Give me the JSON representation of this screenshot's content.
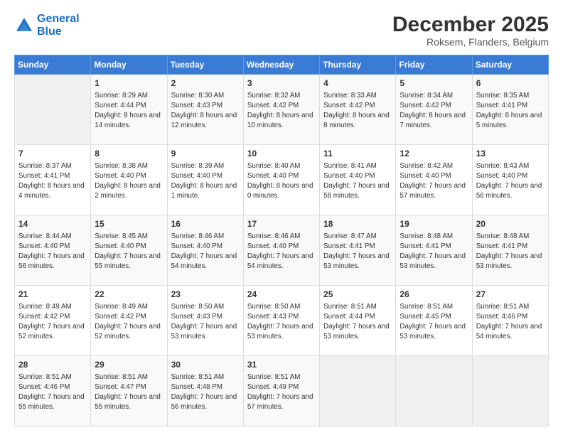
{
  "logo": {
    "line1": "General",
    "line2": "Blue"
  },
  "calendar": {
    "title": "December 2025",
    "subtitle": "Roksem, Flanders, Belgium",
    "days_header": [
      "Sunday",
      "Monday",
      "Tuesday",
      "Wednesday",
      "Thursday",
      "Friday",
      "Saturday"
    ],
    "weeks": [
      [
        {
          "day": "",
          "sunrise": "",
          "sunset": "",
          "daylight": "",
          "empty": true
        },
        {
          "day": "1",
          "sunrise": "Sunrise: 8:29 AM",
          "sunset": "Sunset: 4:44 PM",
          "daylight": "Daylight: 8 hours and 14 minutes."
        },
        {
          "day": "2",
          "sunrise": "Sunrise: 8:30 AM",
          "sunset": "Sunset: 4:43 PM",
          "daylight": "Daylight: 8 hours and 12 minutes."
        },
        {
          "day": "3",
          "sunrise": "Sunrise: 8:32 AM",
          "sunset": "Sunset: 4:42 PM",
          "daylight": "Daylight: 8 hours and 10 minutes."
        },
        {
          "day": "4",
          "sunrise": "Sunrise: 8:33 AM",
          "sunset": "Sunset: 4:42 PM",
          "daylight": "Daylight: 8 hours and 8 minutes."
        },
        {
          "day": "5",
          "sunrise": "Sunrise: 8:34 AM",
          "sunset": "Sunset: 4:42 PM",
          "daylight": "Daylight: 8 hours and 7 minutes."
        },
        {
          "day": "6",
          "sunrise": "Sunrise: 8:35 AM",
          "sunset": "Sunset: 4:41 PM",
          "daylight": "Daylight: 8 hours and 5 minutes."
        }
      ],
      [
        {
          "day": "7",
          "sunrise": "Sunrise: 8:37 AM",
          "sunset": "Sunset: 4:41 PM",
          "daylight": "Daylight: 8 hours and 4 minutes."
        },
        {
          "day": "8",
          "sunrise": "Sunrise: 8:38 AM",
          "sunset": "Sunset: 4:40 PM",
          "daylight": "Daylight: 8 hours and 2 minutes."
        },
        {
          "day": "9",
          "sunrise": "Sunrise: 8:39 AM",
          "sunset": "Sunset: 4:40 PM",
          "daylight": "Daylight: 8 hours and 1 minute."
        },
        {
          "day": "10",
          "sunrise": "Sunrise: 8:40 AM",
          "sunset": "Sunset: 4:40 PM",
          "daylight": "Daylight: 8 hours and 0 minutes."
        },
        {
          "day": "11",
          "sunrise": "Sunrise: 8:41 AM",
          "sunset": "Sunset: 4:40 PM",
          "daylight": "Daylight: 7 hours and 58 minutes."
        },
        {
          "day": "12",
          "sunrise": "Sunrise: 8:42 AM",
          "sunset": "Sunset: 4:40 PM",
          "daylight": "Daylight: 7 hours and 57 minutes."
        },
        {
          "day": "13",
          "sunrise": "Sunrise: 8:43 AM",
          "sunset": "Sunset: 4:40 PM",
          "daylight": "Daylight: 7 hours and 56 minutes."
        }
      ],
      [
        {
          "day": "14",
          "sunrise": "Sunrise: 8:44 AM",
          "sunset": "Sunset: 4:40 PM",
          "daylight": "Daylight: 7 hours and 56 minutes."
        },
        {
          "day": "15",
          "sunrise": "Sunrise: 8:45 AM",
          "sunset": "Sunset: 4:40 PM",
          "daylight": "Daylight: 7 hours and 55 minutes."
        },
        {
          "day": "16",
          "sunrise": "Sunrise: 8:46 AM",
          "sunset": "Sunset: 4:40 PM",
          "daylight": "Daylight: 7 hours and 54 minutes."
        },
        {
          "day": "17",
          "sunrise": "Sunrise: 8:46 AM",
          "sunset": "Sunset: 4:40 PM",
          "daylight": "Daylight: 7 hours and 54 minutes."
        },
        {
          "day": "18",
          "sunrise": "Sunrise: 8:47 AM",
          "sunset": "Sunset: 4:41 PM",
          "daylight": "Daylight: 7 hours and 53 minutes."
        },
        {
          "day": "19",
          "sunrise": "Sunrise: 8:48 AM",
          "sunset": "Sunset: 4:41 PM",
          "daylight": "Daylight: 7 hours and 53 minutes."
        },
        {
          "day": "20",
          "sunrise": "Sunrise: 8:48 AM",
          "sunset": "Sunset: 4:41 PM",
          "daylight": "Daylight: 7 hours and 53 minutes."
        }
      ],
      [
        {
          "day": "21",
          "sunrise": "Sunrise: 8:49 AM",
          "sunset": "Sunset: 4:42 PM",
          "daylight": "Daylight: 7 hours and 52 minutes."
        },
        {
          "day": "22",
          "sunrise": "Sunrise: 8:49 AM",
          "sunset": "Sunset: 4:42 PM",
          "daylight": "Daylight: 7 hours and 52 minutes."
        },
        {
          "day": "23",
          "sunrise": "Sunrise: 8:50 AM",
          "sunset": "Sunset: 4:43 PM",
          "daylight": "Daylight: 7 hours and 53 minutes."
        },
        {
          "day": "24",
          "sunrise": "Sunrise: 8:50 AM",
          "sunset": "Sunset: 4:43 PM",
          "daylight": "Daylight: 7 hours and 53 minutes."
        },
        {
          "day": "25",
          "sunrise": "Sunrise: 8:51 AM",
          "sunset": "Sunset: 4:44 PM",
          "daylight": "Daylight: 7 hours and 53 minutes."
        },
        {
          "day": "26",
          "sunrise": "Sunrise: 8:51 AM",
          "sunset": "Sunset: 4:45 PM",
          "daylight": "Daylight: 7 hours and 53 minutes."
        },
        {
          "day": "27",
          "sunrise": "Sunrise: 8:51 AM",
          "sunset": "Sunset: 4:46 PM",
          "daylight": "Daylight: 7 hours and 54 minutes."
        }
      ],
      [
        {
          "day": "28",
          "sunrise": "Sunrise: 8:51 AM",
          "sunset": "Sunset: 4:46 PM",
          "daylight": "Daylight: 7 hours and 55 minutes."
        },
        {
          "day": "29",
          "sunrise": "Sunrise: 8:51 AM",
          "sunset": "Sunset: 4:47 PM",
          "daylight": "Daylight: 7 hours and 55 minutes."
        },
        {
          "day": "30",
          "sunrise": "Sunrise: 8:51 AM",
          "sunset": "Sunset: 4:48 PM",
          "daylight": "Daylight: 7 hours and 56 minutes."
        },
        {
          "day": "31",
          "sunrise": "Sunrise: 8:51 AM",
          "sunset": "Sunset: 4:49 PM",
          "daylight": "Daylight: 7 hours and 57 minutes."
        },
        {
          "day": "",
          "sunrise": "",
          "sunset": "",
          "daylight": "",
          "empty": true
        },
        {
          "day": "",
          "sunrise": "",
          "sunset": "",
          "daylight": "",
          "empty": true
        },
        {
          "day": "",
          "sunrise": "",
          "sunset": "",
          "daylight": "",
          "empty": true
        }
      ]
    ]
  }
}
